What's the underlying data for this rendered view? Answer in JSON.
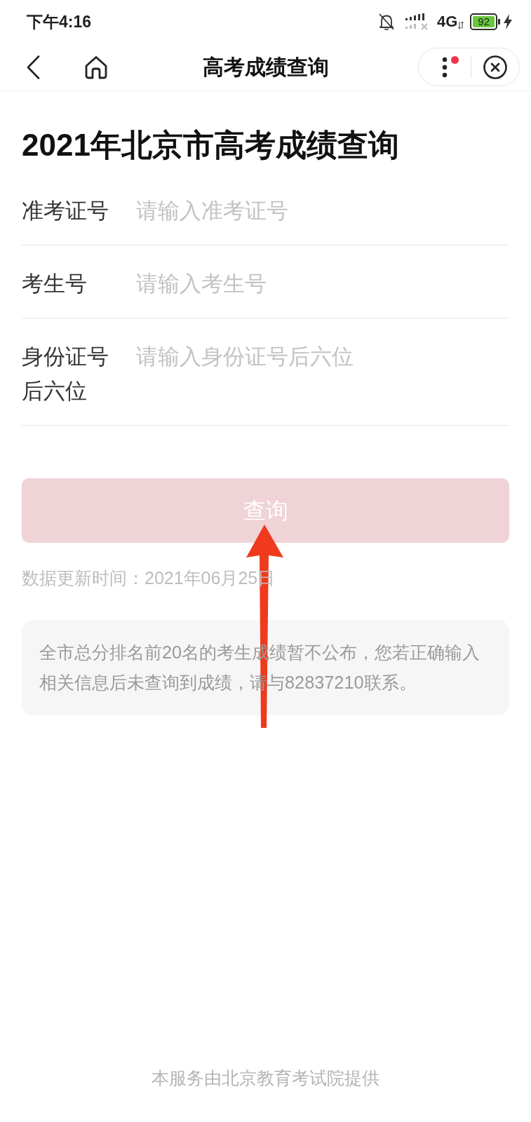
{
  "status_bar": {
    "time": "下午4:16",
    "network": "4G",
    "battery": "92"
  },
  "nav_bar": {
    "title": "高考成绩查询",
    "menu_badge": true
  },
  "heading": "2021年北京市高考成绩查询",
  "form_fields": [
    {
      "label": "准考证号",
      "placeholder": "请输入准考证号"
    },
    {
      "label": "考生号",
      "placeholder": "请输入考生号"
    },
    {
      "label": "身份证号后六位",
      "placeholder": "请输入身份证号后六位"
    }
  ],
  "submit_button": {
    "label": "查询",
    "disabled": true
  },
  "update_note": "数据更新时间：2021年06月25日",
  "notice": "全市总分排名前20名的考生成绩暂不公布，您若正确输入相关信息后未查询到成绩，请与82837210联系。",
  "footer": "本服务由北京教育考试院提供",
  "annotations": [
    {
      "kind": "arrow"
    }
  ]
}
